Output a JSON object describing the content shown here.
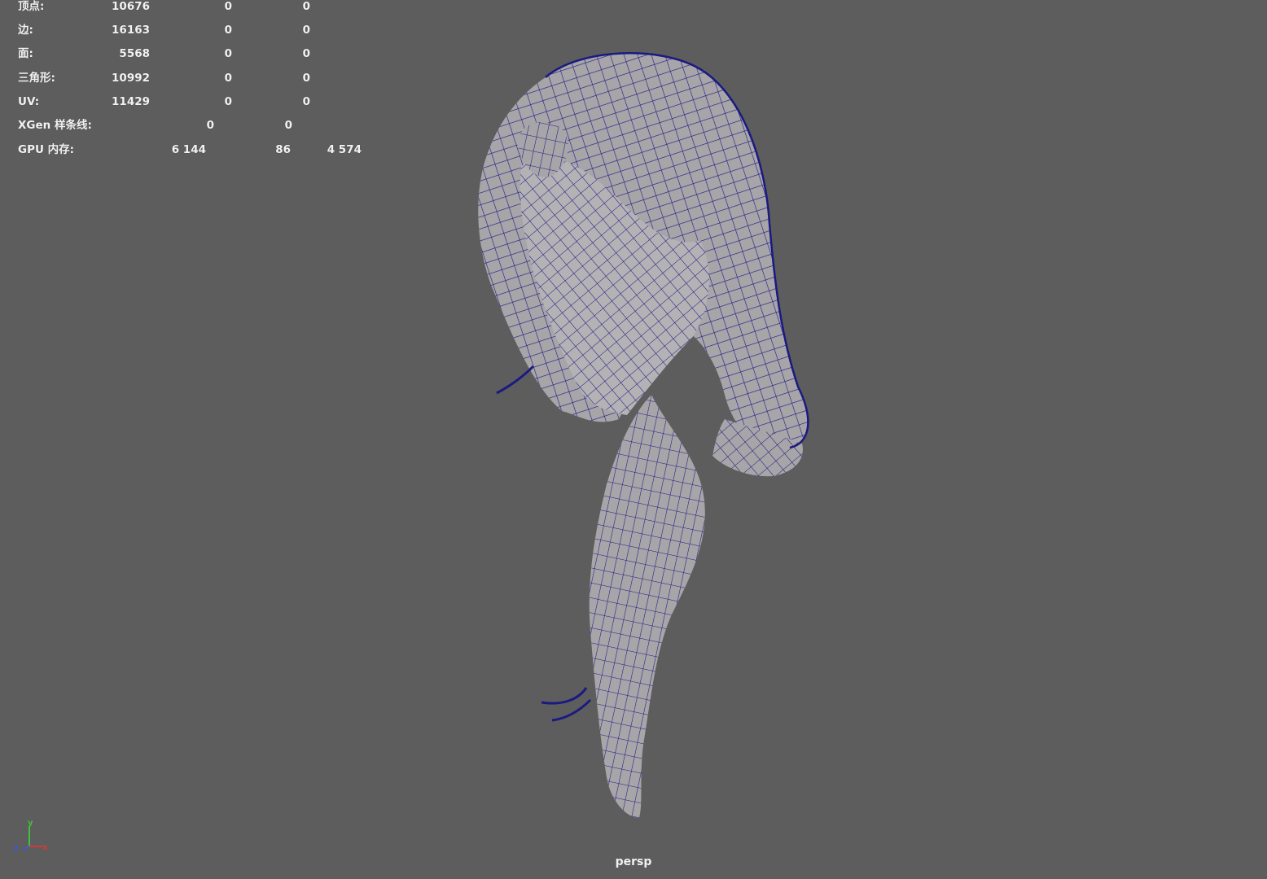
{
  "viewport": {
    "background_color": "#5d5d5d",
    "camera_label": "persp"
  },
  "hud": {
    "rows": [
      {
        "label": "顶点:",
        "values": [
          "10676",
          "0",
          "0"
        ]
      },
      {
        "label": "边:",
        "values": [
          "16163",
          "0",
          "0"
        ]
      },
      {
        "label": "面:",
        "values": [
          "5568",
          "0",
          "0"
        ]
      },
      {
        "label": "三角形:",
        "values": [
          "10992",
          "0",
          "0"
        ]
      },
      {
        "label": "UV:",
        "values": [
          "11429",
          "0",
          "0"
        ]
      },
      {
        "label": "XGen 样条线:",
        "values": [
          "0",
          "0"
        ]
      },
      {
        "label": "GPU 内存:",
        "values": [
          "6 144",
          "86",
          "4 574"
        ]
      }
    ]
  },
  "model": {
    "name": "hair-mesh",
    "surface_color": "#a8a5a8",
    "wire_color": "#1a1a82"
  },
  "axis_gizmo": {
    "labels": {
      "x": "x",
      "y": "y",
      "z": "z"
    },
    "colors": {
      "x": "#d23a3a",
      "y": "#3ec13e",
      "z": "#3a5bd9"
    }
  }
}
